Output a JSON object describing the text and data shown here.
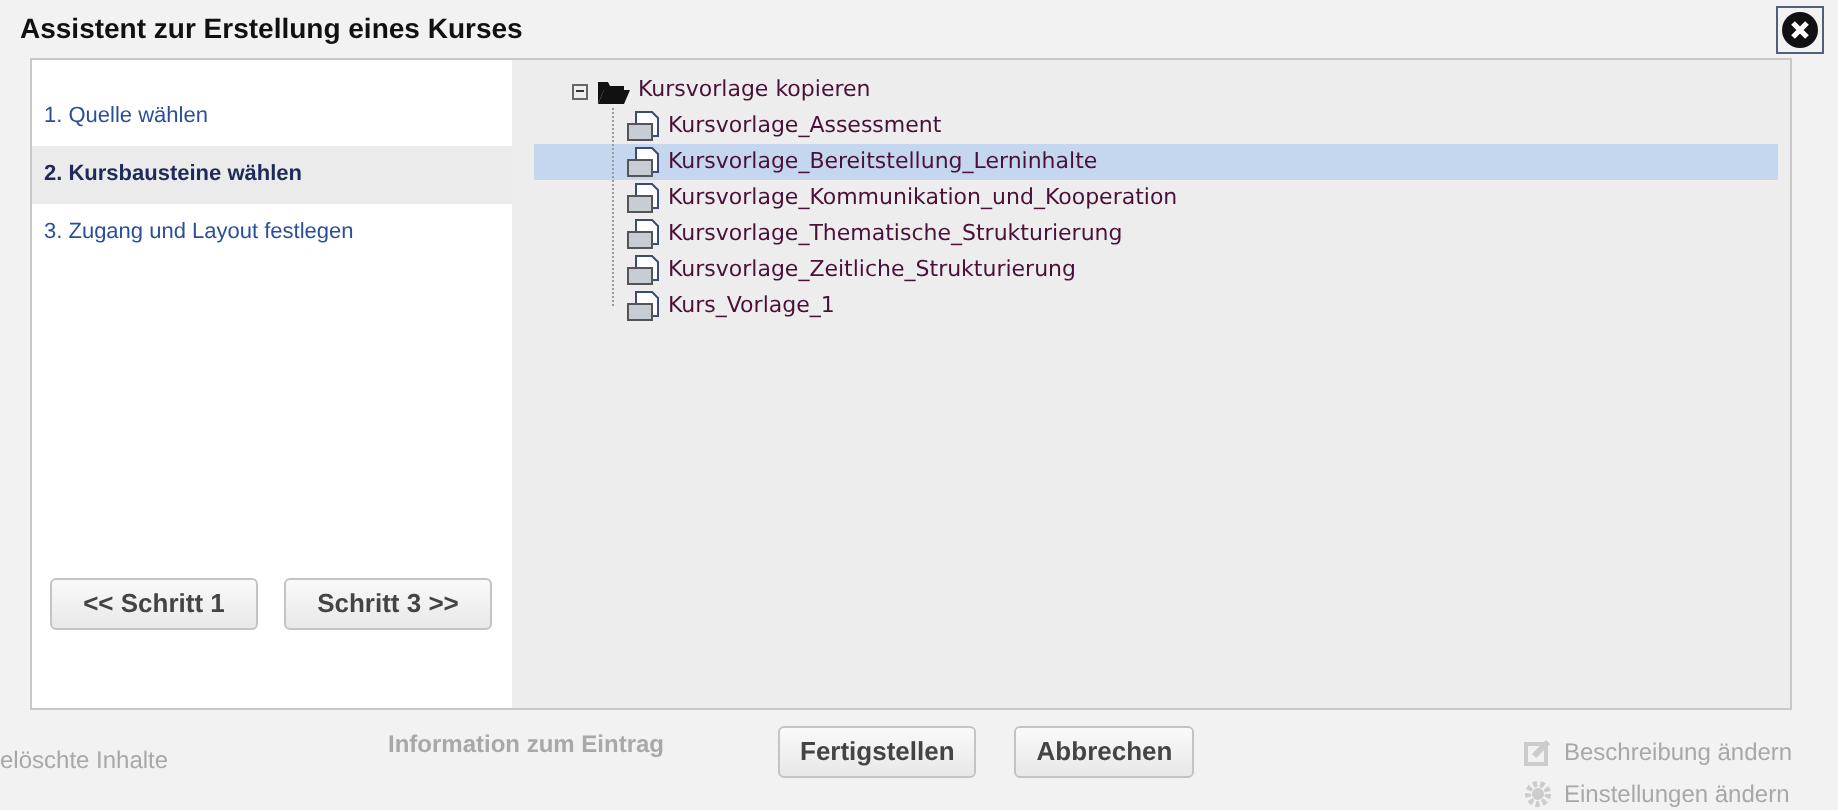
{
  "window": {
    "title": "Assistent zur Erstellung eines Kurses"
  },
  "steps": [
    {
      "label": "1. Quelle wählen",
      "selected": false
    },
    {
      "label": "2. Kursbausteine wählen",
      "selected": true
    },
    {
      "label": "3. Zugang und Layout festlegen",
      "selected": false
    }
  ],
  "nav_buttons": [
    "<< Schritt 1",
    "Schritt 3 >>"
  ],
  "tree": {
    "label": "Kursvorlage kopieren",
    "expanded": true,
    "children": [
      {
        "label": "Kursvorlage_Assessment",
        "selected": false
      },
      {
        "label": "Kursvorlage_Bereitstellung_Lerninhalte",
        "selected": true
      },
      {
        "label": "Kursvorlage_Kommunikation_und_Kooperation",
        "selected": false
      },
      {
        "label": "Kursvorlage_Thematische_Strukturierung",
        "selected": false
      },
      {
        "label": "Kursvorlage_Zeitliche_Strukturierung",
        "selected": false
      },
      {
        "label": "Kurs_Vorlage_1",
        "selected": false
      }
    ]
  },
  "footer_buttons": [
    "Fertigstellen",
    "Abbrechen"
  ],
  "background": {
    "sidebar_item": "elöschte Inhalte",
    "section_title": "Information zum Eintrag",
    "actions": [
      {
        "label": "Beschreibung ändern",
        "kind": "edit"
      },
      {
        "label": "Einstellungen ändern",
        "kind": "settings"
      }
    ]
  }
}
